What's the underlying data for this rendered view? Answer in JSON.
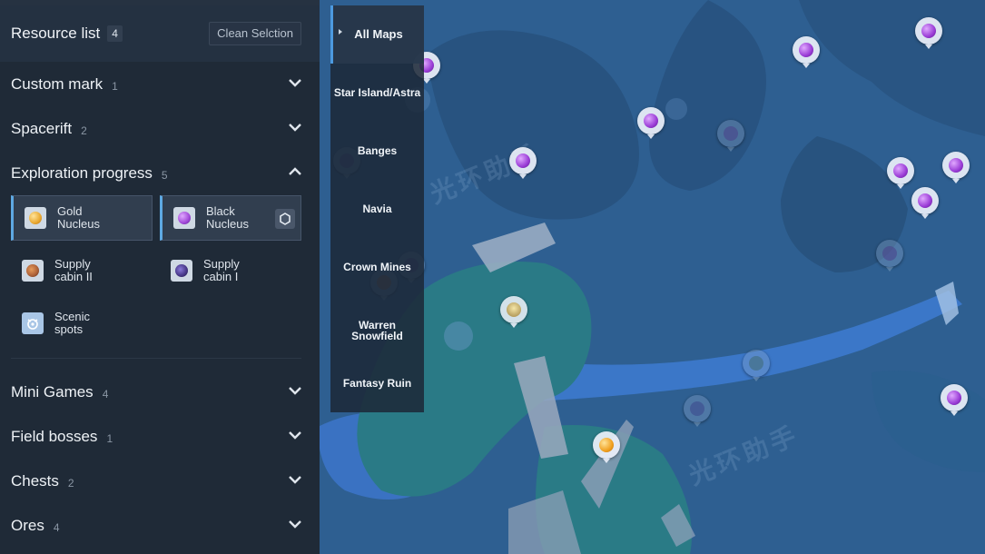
{
  "panel": {
    "resource_list": {
      "title": "Resource list",
      "count": "4",
      "clean_button": "Clean Selction"
    },
    "categories_top": [
      {
        "label": "Custom mark",
        "count": "1",
        "expanded": false
      },
      {
        "label": "Spacerift",
        "count": "2",
        "expanded": false
      },
      {
        "label": "Exploration progress",
        "count": "5",
        "expanded": true
      }
    ],
    "exploration_items": [
      {
        "line1": "Gold",
        "line2": "Nucleus",
        "icon": "gold-nucleus-icon",
        "color": "#e9a830",
        "selected": true
      },
      {
        "line1": "Black",
        "line2": "Nucleus",
        "icon": "black-nucleus-icon",
        "color": "#a048d8",
        "selected": true
      },
      {
        "line1": "Supply",
        "line2": "cabin II",
        "icon": "supply-cabin-ii-icon",
        "color": "#b0643a",
        "selected": false
      },
      {
        "line1": "Supply",
        "line2": "cabin I",
        "icon": "supply-cabin-i-icon",
        "color": "#4a3a8c",
        "selected": false
      },
      {
        "line1": "Scenic",
        "line2": "spots",
        "icon": "scenic-spots-icon",
        "color": "#5a8fc0",
        "selected": false
      }
    ],
    "categories_bottom": [
      {
        "label": "Mini Games",
        "count": "4",
        "expanded": false
      },
      {
        "label": "Field bosses",
        "count": "1",
        "expanded": false
      },
      {
        "label": "Chests",
        "count": "2",
        "expanded": false
      },
      {
        "label": "Ores",
        "count": "4",
        "expanded": false
      }
    ]
  },
  "maps": {
    "items": [
      "All Maps",
      "Star Island/Astra",
      "Banges",
      "Navia",
      "Crown Mines",
      "Warren Snowfield",
      "Fantasy Ruin"
    ],
    "active": "All Maps"
  },
  "watermark": "光环助手",
  "colors": {
    "panel_bg": "#1f2a37",
    "accent": "#4c9ae0",
    "black_nucleus": "#a048d8",
    "gold_nucleus": "#e9a830",
    "map_water": "#3a73c4",
    "map_land": "#2d5d8f",
    "map_green": "#2a7b86"
  }
}
